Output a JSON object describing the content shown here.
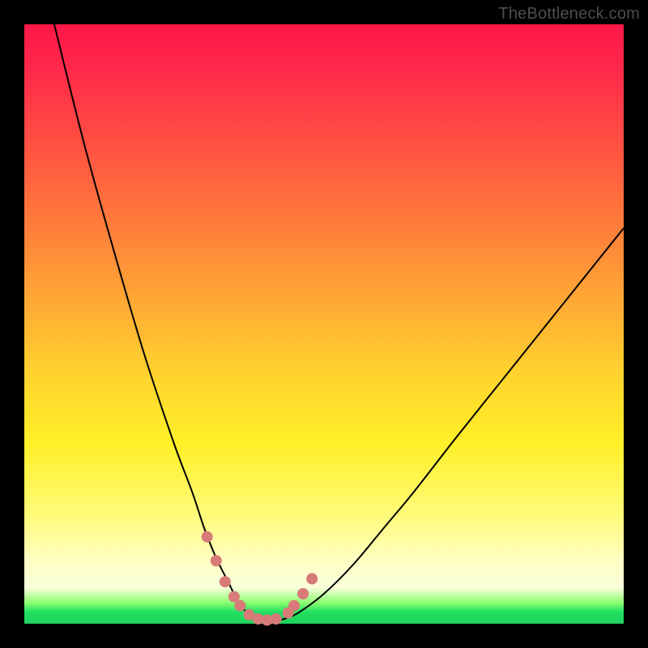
{
  "watermark": "TheBottleneck.com",
  "chart_data": {
    "type": "line",
    "title": "",
    "xlabel": "",
    "ylabel": "",
    "xlim": [
      0,
      1
    ],
    "ylim": [
      0,
      1
    ],
    "background_gradient": {
      "top": "#ff1748",
      "mid_upper": "#ff7e3a",
      "mid": "#ffd22e",
      "mid_lower": "#fffb7a",
      "bottom_band": "#22e060"
    },
    "series": [
      {
        "name": "bottleneck-curve",
        "x": [
          0.05,
          0.1,
          0.15,
          0.2,
          0.25,
          0.28,
          0.3,
          0.32,
          0.34,
          0.355,
          0.37,
          0.385,
          0.4,
          0.42,
          0.44,
          0.46,
          0.5,
          0.55,
          0.6,
          0.65,
          0.72,
          0.8,
          0.88,
          0.96,
          1.0
        ],
        "y": [
          1.0,
          0.8,
          0.62,
          0.45,
          0.3,
          0.22,
          0.16,
          0.11,
          0.07,
          0.04,
          0.02,
          0.01,
          0.005,
          0.005,
          0.01,
          0.02,
          0.05,
          0.1,
          0.16,
          0.22,
          0.31,
          0.41,
          0.51,
          0.61,
          0.66
        ]
      }
    ],
    "markers": {
      "name": "highlight-points",
      "color": "#d87a78",
      "x": [
        0.305,
        0.32,
        0.335,
        0.35,
        0.36,
        0.375,
        0.39,
        0.405,
        0.42,
        0.44,
        0.45,
        0.465,
        0.48
      ],
      "y": [
        0.145,
        0.105,
        0.07,
        0.045,
        0.03,
        0.015,
        0.008,
        0.006,
        0.008,
        0.018,
        0.03,
        0.05,
        0.075
      ]
    }
  }
}
